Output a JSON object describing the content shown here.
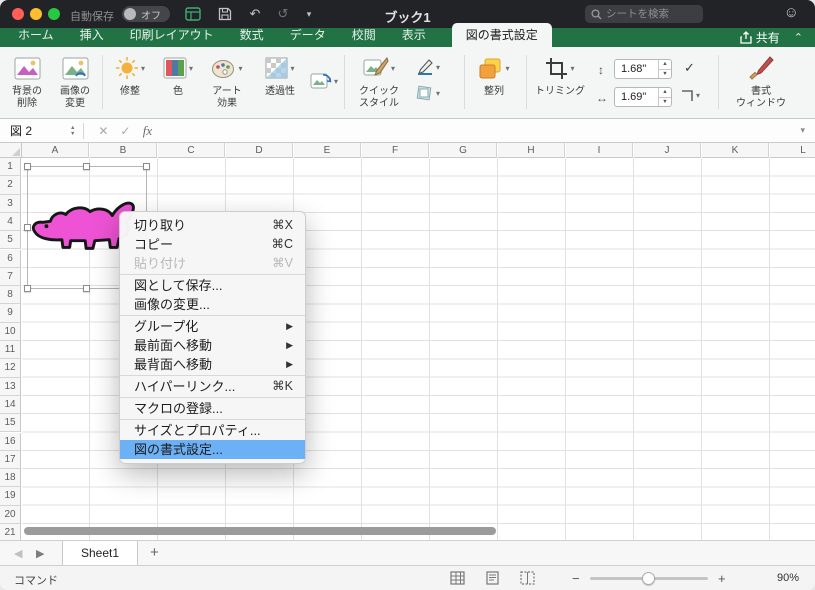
{
  "titlebar": {
    "autosave_label": "自動保存",
    "autosave_state": "オフ",
    "document_title": "ブック1",
    "search_placeholder": "シートを検索"
  },
  "tabs": {
    "items": [
      "ホーム",
      "挿入",
      "印刷レイアウト",
      "数式",
      "データ",
      "校閲",
      "表示",
      "図の書式設定"
    ],
    "active": "図の書式設定",
    "share_label": "共有"
  },
  "ribbon": {
    "remove_background": "背景の\n削除",
    "change_picture": "画像の\n変更",
    "corrections": "修整",
    "color": "色",
    "artistic_effects": "アート\n効果",
    "transparency": "透過性",
    "quick_styles": "クイック\nスタイル",
    "arrange": "整列",
    "crop": "トリミング",
    "format_pane": "書式\nウィンドウ",
    "height_value": "1.68\"",
    "width_value": "1.69\""
  },
  "formula_bar": {
    "name_box": "図 2",
    "fx": "fx"
  },
  "grid": {
    "columns": [
      "A",
      "B",
      "C",
      "D",
      "E",
      "F",
      "G",
      "H",
      "I",
      "J",
      "K",
      "L"
    ],
    "rows": [
      "1",
      "2",
      "3",
      "4",
      "5",
      "6",
      "7",
      "8",
      "9",
      "10",
      "11",
      "12",
      "13",
      "14",
      "15",
      "16",
      "17",
      "18",
      "19",
      "20",
      "21"
    ]
  },
  "context_menu": {
    "items": [
      {
        "label": "切り取り",
        "shortcut": "⌘X"
      },
      {
        "label": "コピー",
        "shortcut": "⌘C"
      },
      {
        "label": "貼り付け",
        "shortcut": "⌘V"
      },
      {
        "label": "図として保存..."
      },
      {
        "label": "画像の変更..."
      },
      {
        "label": "グループ化"
      },
      {
        "label": "最前面へ移動"
      },
      {
        "label": "最背面へ移動"
      },
      {
        "label": "ハイパーリンク...",
        "shortcut": "⌘K"
      },
      {
        "label": "マクロの登録..."
      },
      {
        "label": "サイズとプロパティ..."
      },
      {
        "label": "図の書式設定..."
      }
    ]
  },
  "sheet_bar": {
    "sheet_name": "Sheet1",
    "add": "+"
  },
  "status_bar": {
    "mode": "コマンド",
    "zoom": "90%"
  },
  "icons": {
    "caret_down": "▾",
    "chevron_up": "⌃",
    "close_x": "✕",
    "check": "✓",
    "undo": "↶",
    "redo": "↺",
    "height_arrow": "↕",
    "width_arrow": "↔",
    "nav_left": "◀",
    "nav_right": "▶",
    "stepper_up": "▲",
    "stepper_down": "▼",
    "minus": "−",
    "plus": "+",
    "smiley": "☺",
    "submenu_arrow": "▶"
  }
}
